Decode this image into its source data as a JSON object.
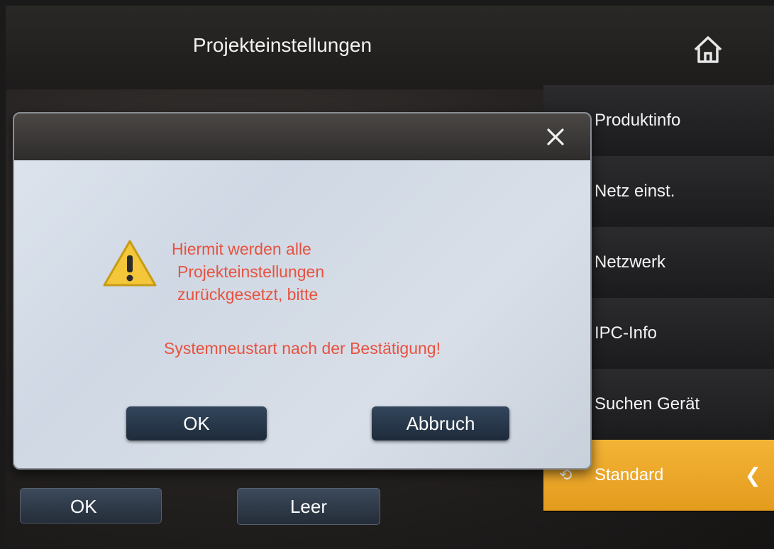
{
  "header": {
    "title": "Projekteinstellungen"
  },
  "sidebar": {
    "items": [
      {
        "label": "Produktinfo"
      },
      {
        "label": "Netz einst."
      },
      {
        "label": "Netzwerk"
      },
      {
        "label": "IPC-Info"
      },
      {
        "label": "Suchen Gerät"
      },
      {
        "label": "Standard",
        "active": true
      }
    ]
  },
  "dialog": {
    "message_lines": [
      "Hiermit werden alle",
      "Projekteinstellungen",
      "zurückgesetzt, bitte"
    ],
    "message_footer": "Systemneustart nach der Bestätigung!",
    "ok_label": "OK",
    "cancel_label": "Abbruch"
  },
  "footer": {
    "ok_label": "OK",
    "clear_label": "Leer"
  },
  "colors": {
    "accent": "#f0a92a",
    "warning_text": "#e8523f"
  }
}
